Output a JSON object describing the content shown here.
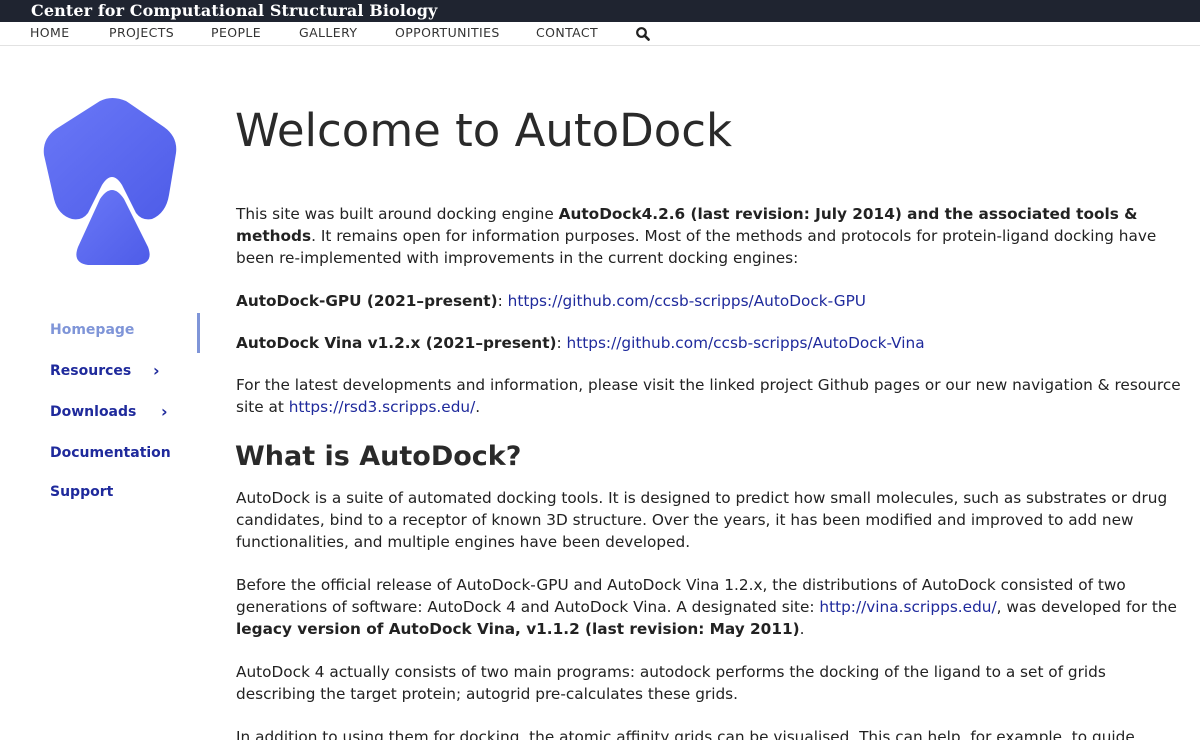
{
  "header": {
    "site_title": "Center for Computational Structural Biology"
  },
  "nav": {
    "items": [
      "HOME",
      "PROJECTS",
      "PEOPLE",
      "GALLERY",
      "OPPORTUNITIES",
      "CONTACT"
    ],
    "search_icon": "search-icon"
  },
  "sidebar": {
    "items": [
      {
        "label": "Homepage",
        "active": true
      },
      {
        "label": "Resources",
        "chevron": "›"
      },
      {
        "label": "Downloads",
        "chevron": "›"
      },
      {
        "label": "Documentation"
      },
      {
        "label": "Support"
      }
    ]
  },
  "main": {
    "title": "Welcome to AutoDock",
    "intro": {
      "before": "This site was built around docking engine ",
      "bold": "AutoDock4.2.6 (last revision: July 2014) and the associated tools & methods",
      "after": ". It remains open for information purposes. Most of the methods and protocols for protein-ligand docking have been re-implemented with improvements in the current docking engines:"
    },
    "gpu": {
      "label": "AutoDock-GPU (2021–present)",
      "sep": ": ",
      "link": "https://github.com/ccsb-scripps/AutoDock-GPU"
    },
    "vina": {
      "label": "AutoDock Vina v1.2.x (2021–present)",
      "sep": ": ",
      "link": "https://github.com/ccsb-scripps/AutoDock-Vina"
    },
    "latest": {
      "text": "For the latest developments and information, please visit the linked project Github pages or our new navigation & resource site at ",
      "link": "https://rsd3.scripps.edu/",
      "after": "."
    },
    "what_heading": "What is AutoDock?",
    "what_p1": "AutoDock is a suite of automated docking tools. It is designed to predict how small molecules, such as substrates or drug candidates, bind to a receptor of known 3D structure. Over the years, it has been modified and improved to add new functionalities, and multiple engines have been developed.",
    "what_p2": {
      "before": "Before the official release of AutoDock-GPU and AutoDock Vina 1.2.x, the distributions of AutoDock consisted of two generations of software: AutoDock 4 and AutoDock Vina. A designated site: ",
      "link": "http://vina.scripps.edu/",
      "middle": ", was developed for the ",
      "bold": "legacy version of AutoDock Vina, v1.1.2 (last revision: May 2011)",
      "after": "."
    },
    "what_p3": "AutoDock 4 actually consists of two main programs: autodock performs the docking of the ligand to a set of grids describing the target protein; autogrid pre-calculates these grids.",
    "what_p4": "In addition to using them for docking, the atomic affinity grids can be visualised. This can help, for example, to guide organic"
  },
  "colors": {
    "topbar": "#1f2430",
    "link": "#1f2a9c",
    "active": "#7f95d8",
    "logo": "#5e6cf2"
  }
}
